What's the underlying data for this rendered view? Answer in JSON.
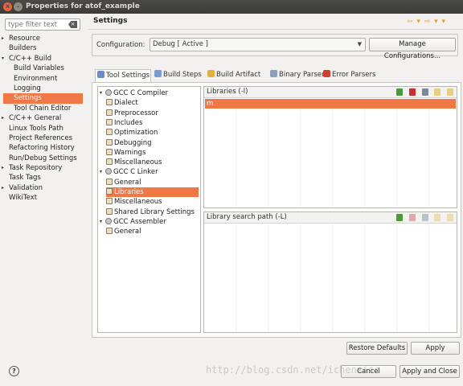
{
  "window": {
    "title": "Properties for atof_example",
    "close_glyph": "×",
    "min_glyph": "–"
  },
  "filter": {
    "placeholder": "type filter text",
    "clear_glyph": "×"
  },
  "nav": [
    {
      "label": "Resource",
      "arrow": "▸"
    },
    {
      "label": "Builders"
    },
    {
      "label": "C/C++ Build",
      "arrow": "▾"
    },
    {
      "label": "Build Variables"
    },
    {
      "label": "Environment"
    },
    {
      "label": "Logging"
    },
    {
      "label": "Settings"
    },
    {
      "label": "Tool Chain Editor"
    },
    {
      "label": "C/C++ General",
      "arrow": "▸"
    },
    {
      "label": "Linux Tools Path"
    },
    {
      "label": "Project References"
    },
    {
      "label": "Refactoring History"
    },
    {
      "label": "Run/Debug Settings"
    },
    {
      "label": "Task Repository",
      "arrow": "▸"
    },
    {
      "label": "Task Tags"
    },
    {
      "label": "Validation",
      "arrow": "▸"
    },
    {
      "label": "WikiText"
    }
  ],
  "header": {
    "title": "Settings",
    "nav_glyphs": "⇦ ▾ ⇨ ▾ ▾"
  },
  "configuration": {
    "label": "Configuration:",
    "value": "Debug  [ Active ]",
    "dropdown_glyph": "▼",
    "manage_label": "Manage Configurations..."
  },
  "tabs": [
    {
      "label": "Tool Settings",
      "icon_color": "#6a8cc8"
    },
    {
      "label": "Build Steps",
      "icon_color": "#7a9ad0"
    },
    {
      "label": "Build Artifact",
      "icon_color": "#e0b040"
    },
    {
      "label": "Binary Parsers",
      "icon_color": "#8aa0b8"
    },
    {
      "label": "Error Parsers",
      "icon_color": "#d04030"
    }
  ],
  "tree": [
    {
      "label": "GCC C Compiler",
      "arrow": "▾"
    },
    {
      "label": "Dialect"
    },
    {
      "label": "Preprocessor"
    },
    {
      "label": "Includes"
    },
    {
      "label": "Optimization"
    },
    {
      "label": "Debugging"
    },
    {
      "label": "Warnings"
    },
    {
      "label": "Miscellaneous"
    },
    {
      "label": "GCC C Linker",
      "arrow": "▾"
    },
    {
      "label": "General"
    },
    {
      "label": "Libraries"
    },
    {
      "label": "Miscellaneous"
    },
    {
      "label": "Shared Library Settings"
    },
    {
      "label": "GCC Assembler",
      "arrow": "▾"
    },
    {
      "label": "General"
    }
  ],
  "libraries": {
    "title": "Libraries (-l)",
    "items": [
      "m"
    ]
  },
  "library_search_path": {
    "title": "Library search path (-L)"
  },
  "tool_icons": {
    "add": "#4a9a3a",
    "delete": "#c83030",
    "edit": "#7a8a9a",
    "up": "#e0b040",
    "down": "#e0b040"
  },
  "buttons": {
    "restore": "Restore Defaults",
    "apply": "Apply",
    "cancel": "Cancel",
    "apply_close": "Apply and Close",
    "help": "?"
  },
  "watermark": "http://blog.csdn.net/ichenxiao"
}
